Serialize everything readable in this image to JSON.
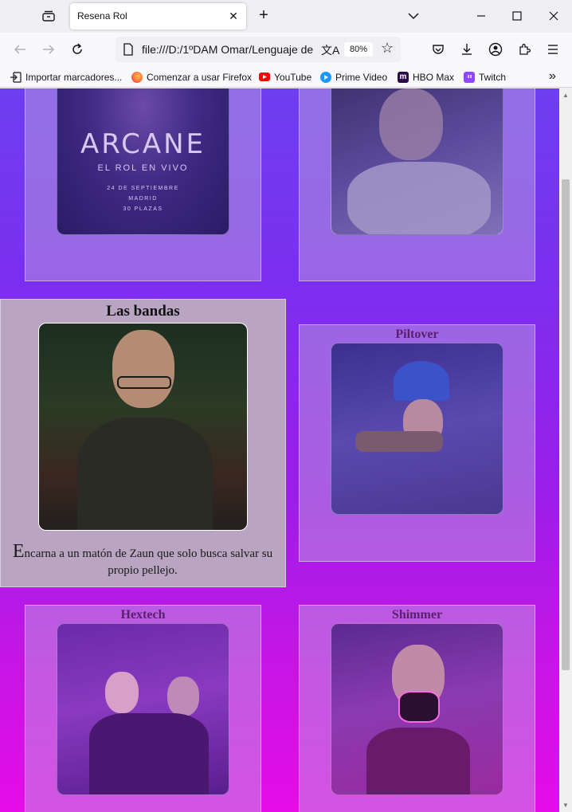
{
  "browser": {
    "tab_title": "Resena Rol",
    "url": "file:///D:/1ºDAM Omar/Lenguaje de",
    "zoom": "80%"
  },
  "bookmarks": [
    {
      "label": "Importar marcadores...",
      "icon": "import-icon"
    },
    {
      "label": "Comenzar a usar Firefox",
      "icon": "firefox-icon",
      "color": "#ff7139"
    },
    {
      "label": "YouTube",
      "icon": "youtube-icon",
      "color": "#ff0000"
    },
    {
      "label": "Prime Video",
      "icon": "prime-video-icon",
      "color": "#1a98ff"
    },
    {
      "label": "HBO Max",
      "icon": "hbo-max-icon",
      "color": "#5822b4"
    },
    {
      "label": "Twitch",
      "icon": "twitch-icon",
      "color": "#9146ff"
    }
  ],
  "poster": {
    "title": "ARCANE",
    "subtitle": "EL ROL EN VIVO",
    "date": "24 DE SEPTIEMBRE",
    "city": "MADRID",
    "places": "30 PLAZAS"
  },
  "cards": {
    "bandas": {
      "title": "Las bandas",
      "desc_initial": "E",
      "desc_rest": "ncarna a un matón de Zaun que solo busca salvar su propio pellejo."
    },
    "piltover": {
      "title": "Piltover"
    },
    "hextech": {
      "title": "Hextech"
    },
    "shimmer": {
      "title": "Shimmer"
    }
  },
  "colors": {
    "page_gradient_top": "#6d3ef0",
    "page_gradient_bottom": "#e50ce8",
    "card_title": "#5a1f6e"
  }
}
